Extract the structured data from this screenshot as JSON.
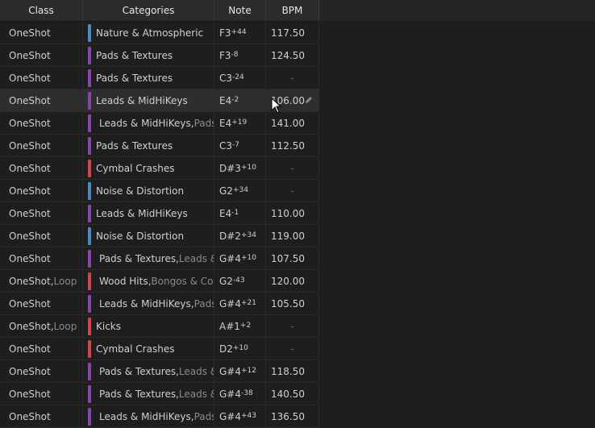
{
  "columns": {
    "class": "Class",
    "categories": "Categories",
    "note": "Note",
    "bpm": "BPM"
  },
  "colors": {
    "nature": "#4a8bbf",
    "pads": "#8a44a8",
    "leads": "#8a44a8",
    "cymbal": "#d6434b",
    "noise": "#4a8bbf",
    "wood": "#d6434b",
    "kicks": "#d6434b"
  },
  "rows": [
    {
      "class": "OneShot",
      "class2": "",
      "cat": "Nature & Atmospheric",
      "cat2": "",
      "color": "#4a8bbf",
      "note": "F3",
      "cents": "+44",
      "bpm": "117.50"
    },
    {
      "class": "OneShot",
      "class2": "",
      "cat": "Pads & Textures",
      "cat2": "",
      "color": "#8a44a8",
      "note": "F3",
      "cents": "-8",
      "bpm": "124.50"
    },
    {
      "class": "OneShot",
      "class2": "",
      "cat": "Pads & Textures",
      "cat2": "",
      "color": "#8a44a8",
      "note": "C3",
      "cents": "-24",
      "bpm": "-"
    },
    {
      "class": "OneShot",
      "class2": "",
      "cat": "Leads & MidHiKeys",
      "cat2": "",
      "color": "#8a44a8",
      "note": "E4",
      "cents": "-2",
      "bpm": "106.00"
    },
    {
      "class": "OneShot",
      "class2": "",
      "cat": "Leads & MidHiKeys,",
      "cat2": " Pads & Textures",
      "color": "#8a44a8",
      "note": "E4",
      "cents": "+19",
      "bpm": "141.00"
    },
    {
      "class": "OneShot",
      "class2": "",
      "cat": "Pads & Textures",
      "cat2": "",
      "color": "#8a44a8",
      "note": "C3",
      "cents": "-7",
      "bpm": "112.50"
    },
    {
      "class": "OneShot",
      "class2": "",
      "cat": "Cymbal Crashes",
      "cat2": "",
      "color": "#d6434b",
      "note": "D#3",
      "cents": "+10",
      "bpm": "-"
    },
    {
      "class": "OneShot",
      "class2": "",
      "cat": "Noise & Distortion",
      "cat2": "",
      "color": "#4a8bbf",
      "note": "G2",
      "cents": "+34",
      "bpm": "-"
    },
    {
      "class": "OneShot",
      "class2": "",
      "cat": "Leads & MidHiKeys",
      "cat2": "",
      "color": "#8a44a8",
      "note": "E4",
      "cents": "-1",
      "bpm": "110.00"
    },
    {
      "class": "OneShot",
      "class2": "",
      "cat": "Noise & Distortion",
      "cat2": "",
      "color": "#4a8bbf",
      "note": "D#2",
      "cents": "+34",
      "bpm": "119.00"
    },
    {
      "class": "OneShot",
      "class2": "",
      "cat": "Pads & Textures,",
      "cat2": " Leads & MidHiKeys",
      "color": "#8a44a8",
      "note": "G#4",
      "cents": "+10",
      "bpm": "107.50"
    },
    {
      "class": "OneShot,",
      "class2": " Loop",
      "cat": "Wood Hits,",
      "cat2": " Bongos & Congas",
      "color": "#d6434b",
      "note": "G2",
      "cents": "-43",
      "bpm": "120.00"
    },
    {
      "class": "OneShot",
      "class2": "",
      "cat": "Leads & MidHiKeys,",
      "cat2": " Pads & Textures",
      "color": "#8a44a8",
      "note": "G#4",
      "cents": "+21",
      "bpm": "105.50"
    },
    {
      "class": "OneShot,",
      "class2": " Loop",
      "cat": "Kicks",
      "cat2": "",
      "color": "#d6434b",
      "note": "A#1",
      "cents": "+2",
      "bpm": "-"
    },
    {
      "class": "OneShot",
      "class2": "",
      "cat": "Cymbal Crashes",
      "cat2": "",
      "color": "#d6434b",
      "note": "D2",
      "cents": "+10",
      "bpm": "-"
    },
    {
      "class": "OneShot",
      "class2": "",
      "cat": "Pads & Textures,",
      "cat2": " Leads & MidHiKeys",
      "color": "#8a44a8",
      "note": "G#4",
      "cents": "+12",
      "bpm": "118.50"
    },
    {
      "class": "OneShot",
      "class2": "",
      "cat": "Pads & Textures,",
      "cat2": " Leads & MidHiKeys",
      "color": "#8a44a8",
      "note": "G#4",
      "cents": "-38",
      "bpm": "140.50"
    },
    {
      "class": "OneShot",
      "class2": "",
      "cat": "Leads & MidHiKeys,",
      "cat2": " Pads & Textures",
      "color": "#8a44a8",
      "note": "G#4",
      "cents": "+43",
      "bpm": "136.50"
    }
  ],
  "hover_row": 3,
  "icons": {
    "edit": "pencil-icon",
    "cursor": "mouse-pointer-icon"
  }
}
